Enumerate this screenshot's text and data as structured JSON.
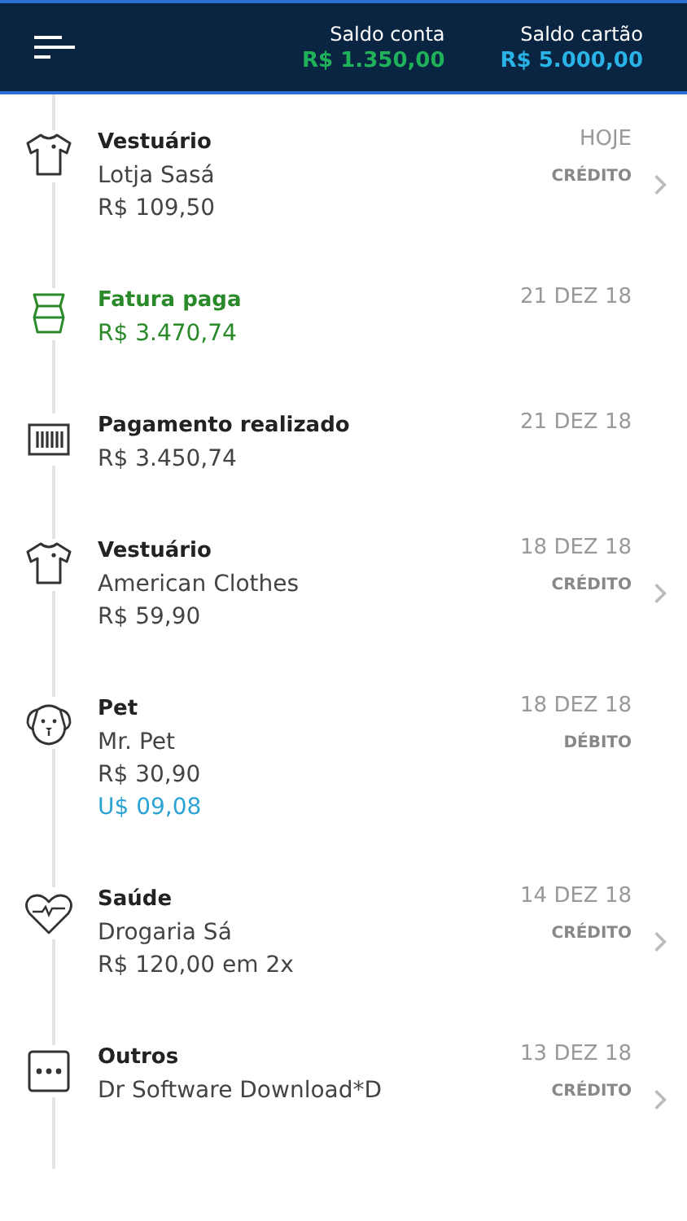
{
  "header": {
    "balances": [
      {
        "label": "Saldo conta",
        "value": "R$ 1.350,00",
        "color": "#1fb25a"
      },
      {
        "label": "Saldo cartão",
        "value": "R$ 5.000,00",
        "color": "#2ab3e6"
      }
    ]
  },
  "transactions": [
    {
      "kind": "shirt",
      "title": "Vestuário",
      "merchant": "Lotja Sasá",
      "amount": "R$ 109,50",
      "date": "HOJE",
      "method": "CRÉDITO",
      "chevron": true,
      "highlight": false
    },
    {
      "kind": "bill",
      "title": "Fatura paga",
      "amount": "R$ 3.470,74",
      "date": "21 DEZ 18",
      "chevron": false,
      "highlight": true
    },
    {
      "kind": "barcode",
      "title": "Pagamento realizado",
      "amount": "R$ 3.450,74",
      "date": "21 DEZ 18",
      "chevron": false,
      "highlight": false
    },
    {
      "kind": "shirt",
      "title": "Vestuário",
      "merchant": "American Clothes",
      "amount": "R$ 59,90",
      "date": "18 DEZ 18",
      "method": "CRÉDITO",
      "chevron": true,
      "highlight": false
    },
    {
      "kind": "dog",
      "title": "Pet",
      "merchant": "Mr. Pet",
      "amount": "R$ 30,90",
      "foreign_amount": "U$ 09,08",
      "date": "18 DEZ 18",
      "method": "DÉBITO",
      "chevron": false,
      "highlight": false
    },
    {
      "kind": "heart",
      "title": "Saúde",
      "merchant": "Drogaria Sá",
      "amount": "R$ 120,00 em 2x",
      "date": "14 DEZ 18",
      "method": "CRÉDITO",
      "chevron": true,
      "highlight": false
    },
    {
      "kind": "dots",
      "title": "Outros",
      "merchant": "Dr Software Download*D",
      "date": "13 DEZ 18",
      "method": "CRÉDITO",
      "chevron": true,
      "highlight": false
    }
  ]
}
